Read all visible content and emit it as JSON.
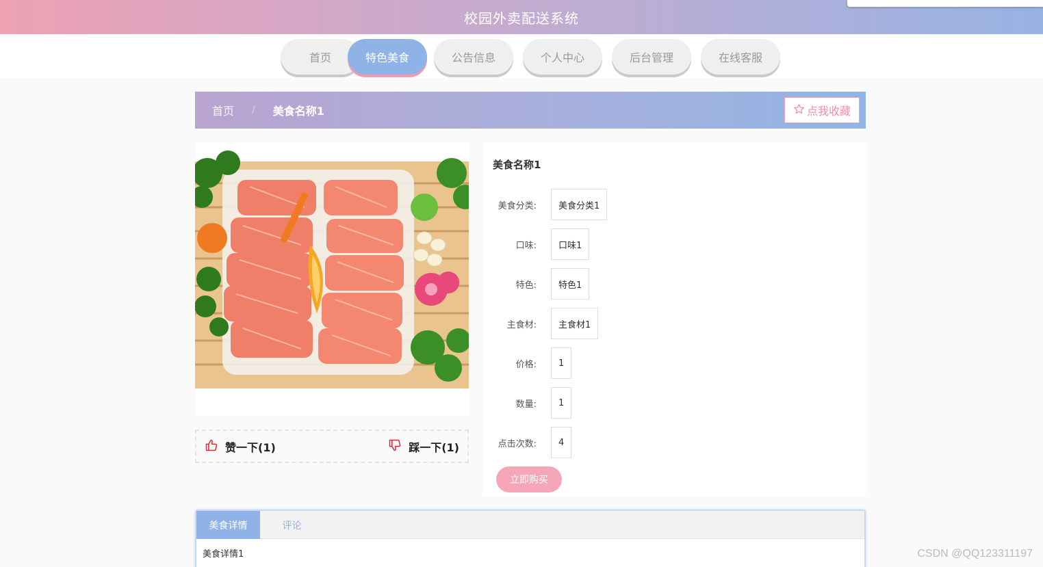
{
  "header": {
    "title": "校园外卖配送系统"
  },
  "nav": {
    "items": [
      {
        "label": "首页"
      },
      {
        "label": "特色美食"
      },
      {
        "label": "公告信息"
      },
      {
        "label": "个人中心"
      },
      {
        "label": "后台管理"
      },
      {
        "label": "在线客服"
      }
    ],
    "active_index": 1
  },
  "breadcrumb": {
    "home": "首页",
    "separator": "/",
    "current": "美食名称1"
  },
  "favorite_button": {
    "label": "点我收藏",
    "icon": "star-outline-icon"
  },
  "votes": {
    "like": {
      "label": "赞一下(1)",
      "icon": "thumbs-up-icon"
    },
    "dislike": {
      "label": "踩一下(1)",
      "icon": "thumbs-down-icon"
    }
  },
  "details": {
    "name": "美食名称1",
    "fields": [
      {
        "label": "美食分类:",
        "value": "美食分类1"
      },
      {
        "label": "口味:",
        "value": "口味1"
      },
      {
        "label": "特色:",
        "value": "特色1"
      },
      {
        "label": "主食材:",
        "value": "主食材1"
      },
      {
        "label": "价格:",
        "value": "1"
      },
      {
        "label": "数量:",
        "value": "1"
      },
      {
        "label": "点击次数:",
        "value": "4"
      }
    ],
    "buy_label": "立即购买"
  },
  "tabs": {
    "items": [
      {
        "label": "美食详情"
      },
      {
        "label": "评论"
      }
    ],
    "active_index": 0,
    "content": "美食详情1"
  },
  "watermark": "CSDN @QQ123311197",
  "colors": {
    "accent_blue": "#8fb3e6",
    "accent_pink": "#f5a6b8",
    "vote_icon": "#e8242c"
  }
}
